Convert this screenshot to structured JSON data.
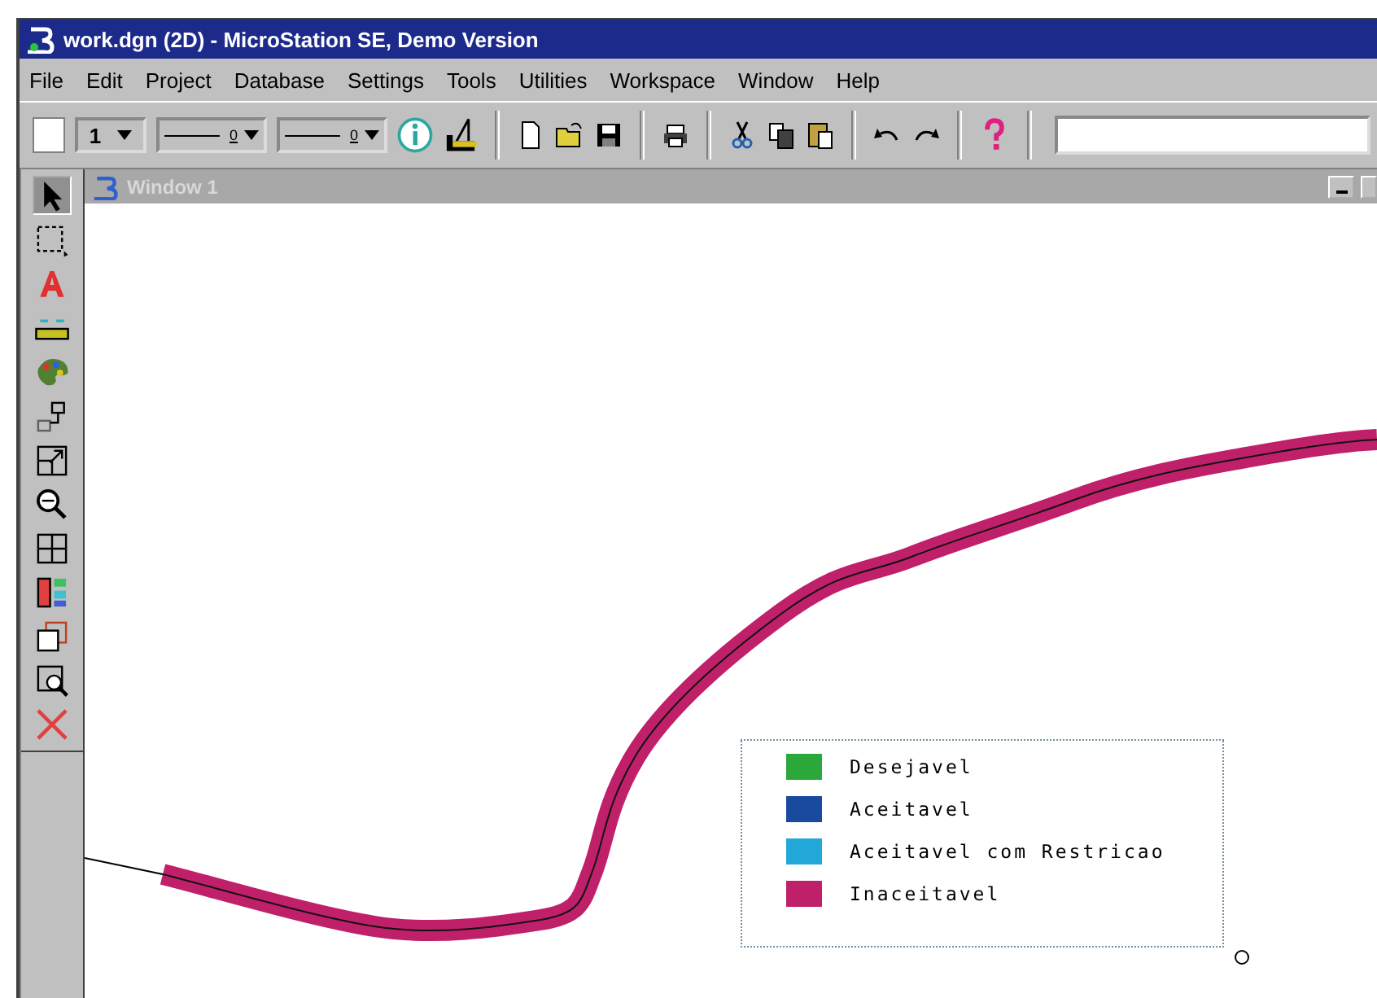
{
  "window": {
    "title": "work.dgn (2D) - MicroStation SE, Demo Version"
  },
  "menu": [
    "File",
    "Edit",
    "Project",
    "Database",
    "Settings",
    "Tools",
    "Utilities",
    "Workspace",
    "Window",
    "Help"
  ],
  "attributes": {
    "level": "1",
    "style": "0",
    "weight": "0"
  },
  "view": {
    "title": "Window 1",
    "active": false
  },
  "legend": [
    {
      "label": "Desejavel",
      "color": "#2aa83a"
    },
    {
      "label": "Aceitavel",
      "color": "#1a4aa0"
    },
    {
      "label": "Aceitavel com Restricao",
      "color": "#22a8d8"
    },
    {
      "label": "Inaceitavel",
      "color": "#c0206a"
    }
  ]
}
